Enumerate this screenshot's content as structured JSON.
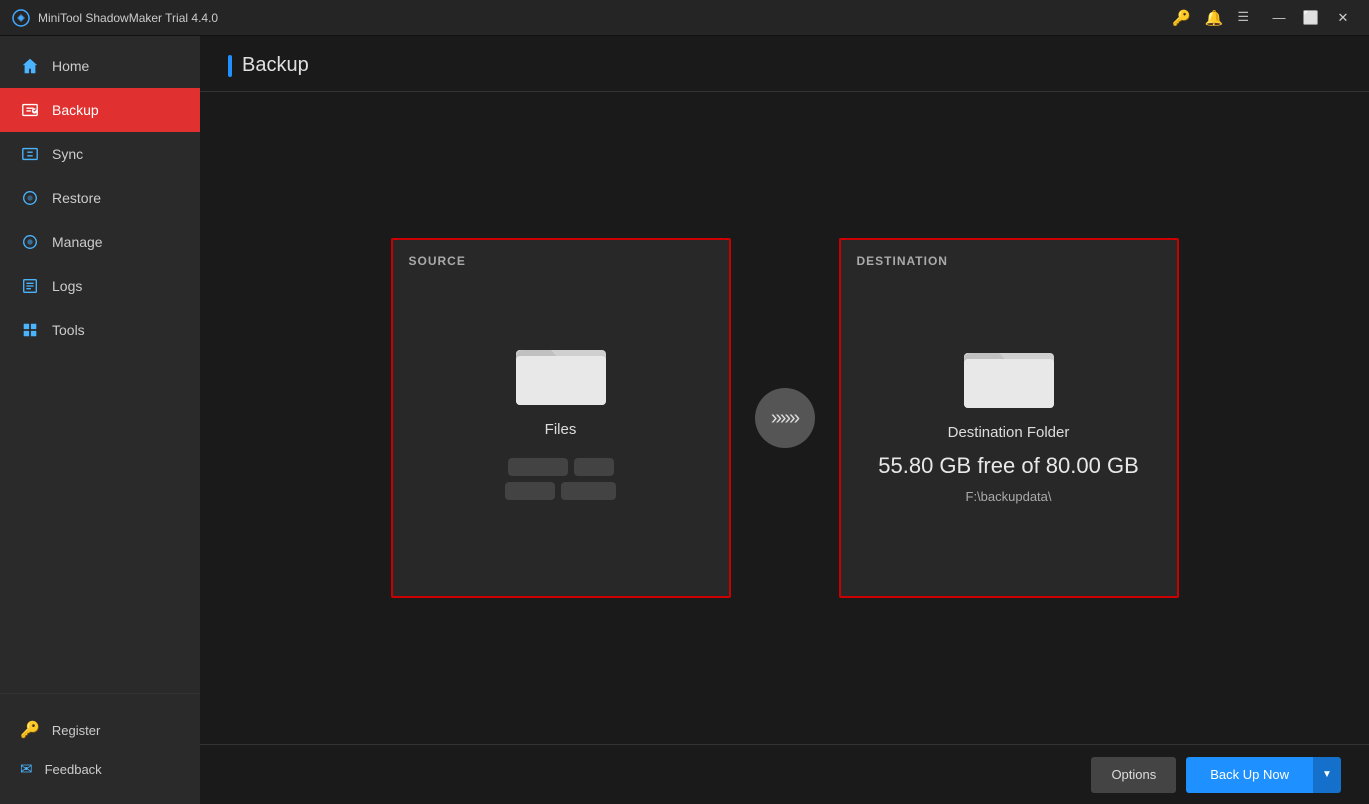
{
  "titleBar": {
    "title": "MiniTool ShadowMaker Trial 4.4.0",
    "icons": {
      "key": "🔑",
      "bell": "🔔",
      "menu": "☰"
    },
    "controls": {
      "minimize": "—",
      "maximize": "⬜",
      "close": "✕"
    }
  },
  "sidebar": {
    "items": [
      {
        "id": "home",
        "label": "Home",
        "active": false
      },
      {
        "id": "backup",
        "label": "Backup",
        "active": true
      },
      {
        "id": "sync",
        "label": "Sync",
        "active": false
      },
      {
        "id": "restore",
        "label": "Restore",
        "active": false
      },
      {
        "id": "manage",
        "label": "Manage",
        "active": false
      },
      {
        "id": "logs",
        "label": "Logs",
        "active": false
      },
      {
        "id": "tools",
        "label": "Tools",
        "active": false
      }
    ],
    "bottom": [
      {
        "id": "register",
        "label": "Register"
      },
      {
        "id": "feedback",
        "label": "Feedback"
      }
    ]
  },
  "content": {
    "title": "Backup",
    "source": {
      "label": "SOURCE",
      "icon": "folder",
      "type": "Files"
    },
    "destination": {
      "label": "DESTINATION",
      "icon": "folder",
      "folder_title": "Destination Folder",
      "storage": "55.80 GB free of 80.00 GB",
      "path": "F:\\backupdata\\"
    },
    "arrow": "»»»"
  },
  "bottomBar": {
    "options_label": "Options",
    "backup_label": "Back Up Now",
    "dropdown_arrow": "▼"
  }
}
